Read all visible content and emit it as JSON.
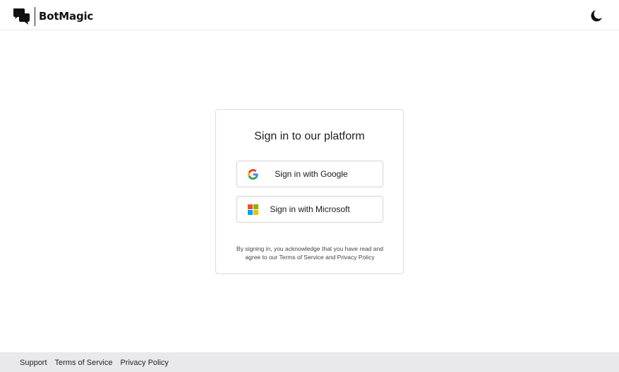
{
  "header": {
    "brand_name": "BotMagic",
    "logo_icon": "speech-bubbles-logo",
    "theme_toggle_icon": "moon-icon"
  },
  "card": {
    "title": "Sign in to our platform",
    "buttons": [
      {
        "provider": "google",
        "label": "Sign in with Google",
        "icon": "google-icon"
      },
      {
        "provider": "microsoft",
        "label": "Sign in with Microsoft",
        "icon": "microsoft-icon"
      }
    ],
    "disclaimer": "By signing in, you acknowledge that you have read and agree to our Terms of Service and Privacy Policy"
  },
  "footer": {
    "links": [
      "Support",
      "Terms of Service",
      "Privacy Policy"
    ]
  },
  "colors": {
    "footer_bg": "#e9e9eb",
    "border": "#dcdcdc",
    "google_blue": "#4285F4",
    "google_red": "#EA4335",
    "google_yellow": "#FBBC05",
    "google_green": "#34A853",
    "ms_red": "#F25022",
    "ms_green": "#7FBA00",
    "ms_blue": "#00A4EF",
    "ms_yellow": "#FFB900"
  }
}
